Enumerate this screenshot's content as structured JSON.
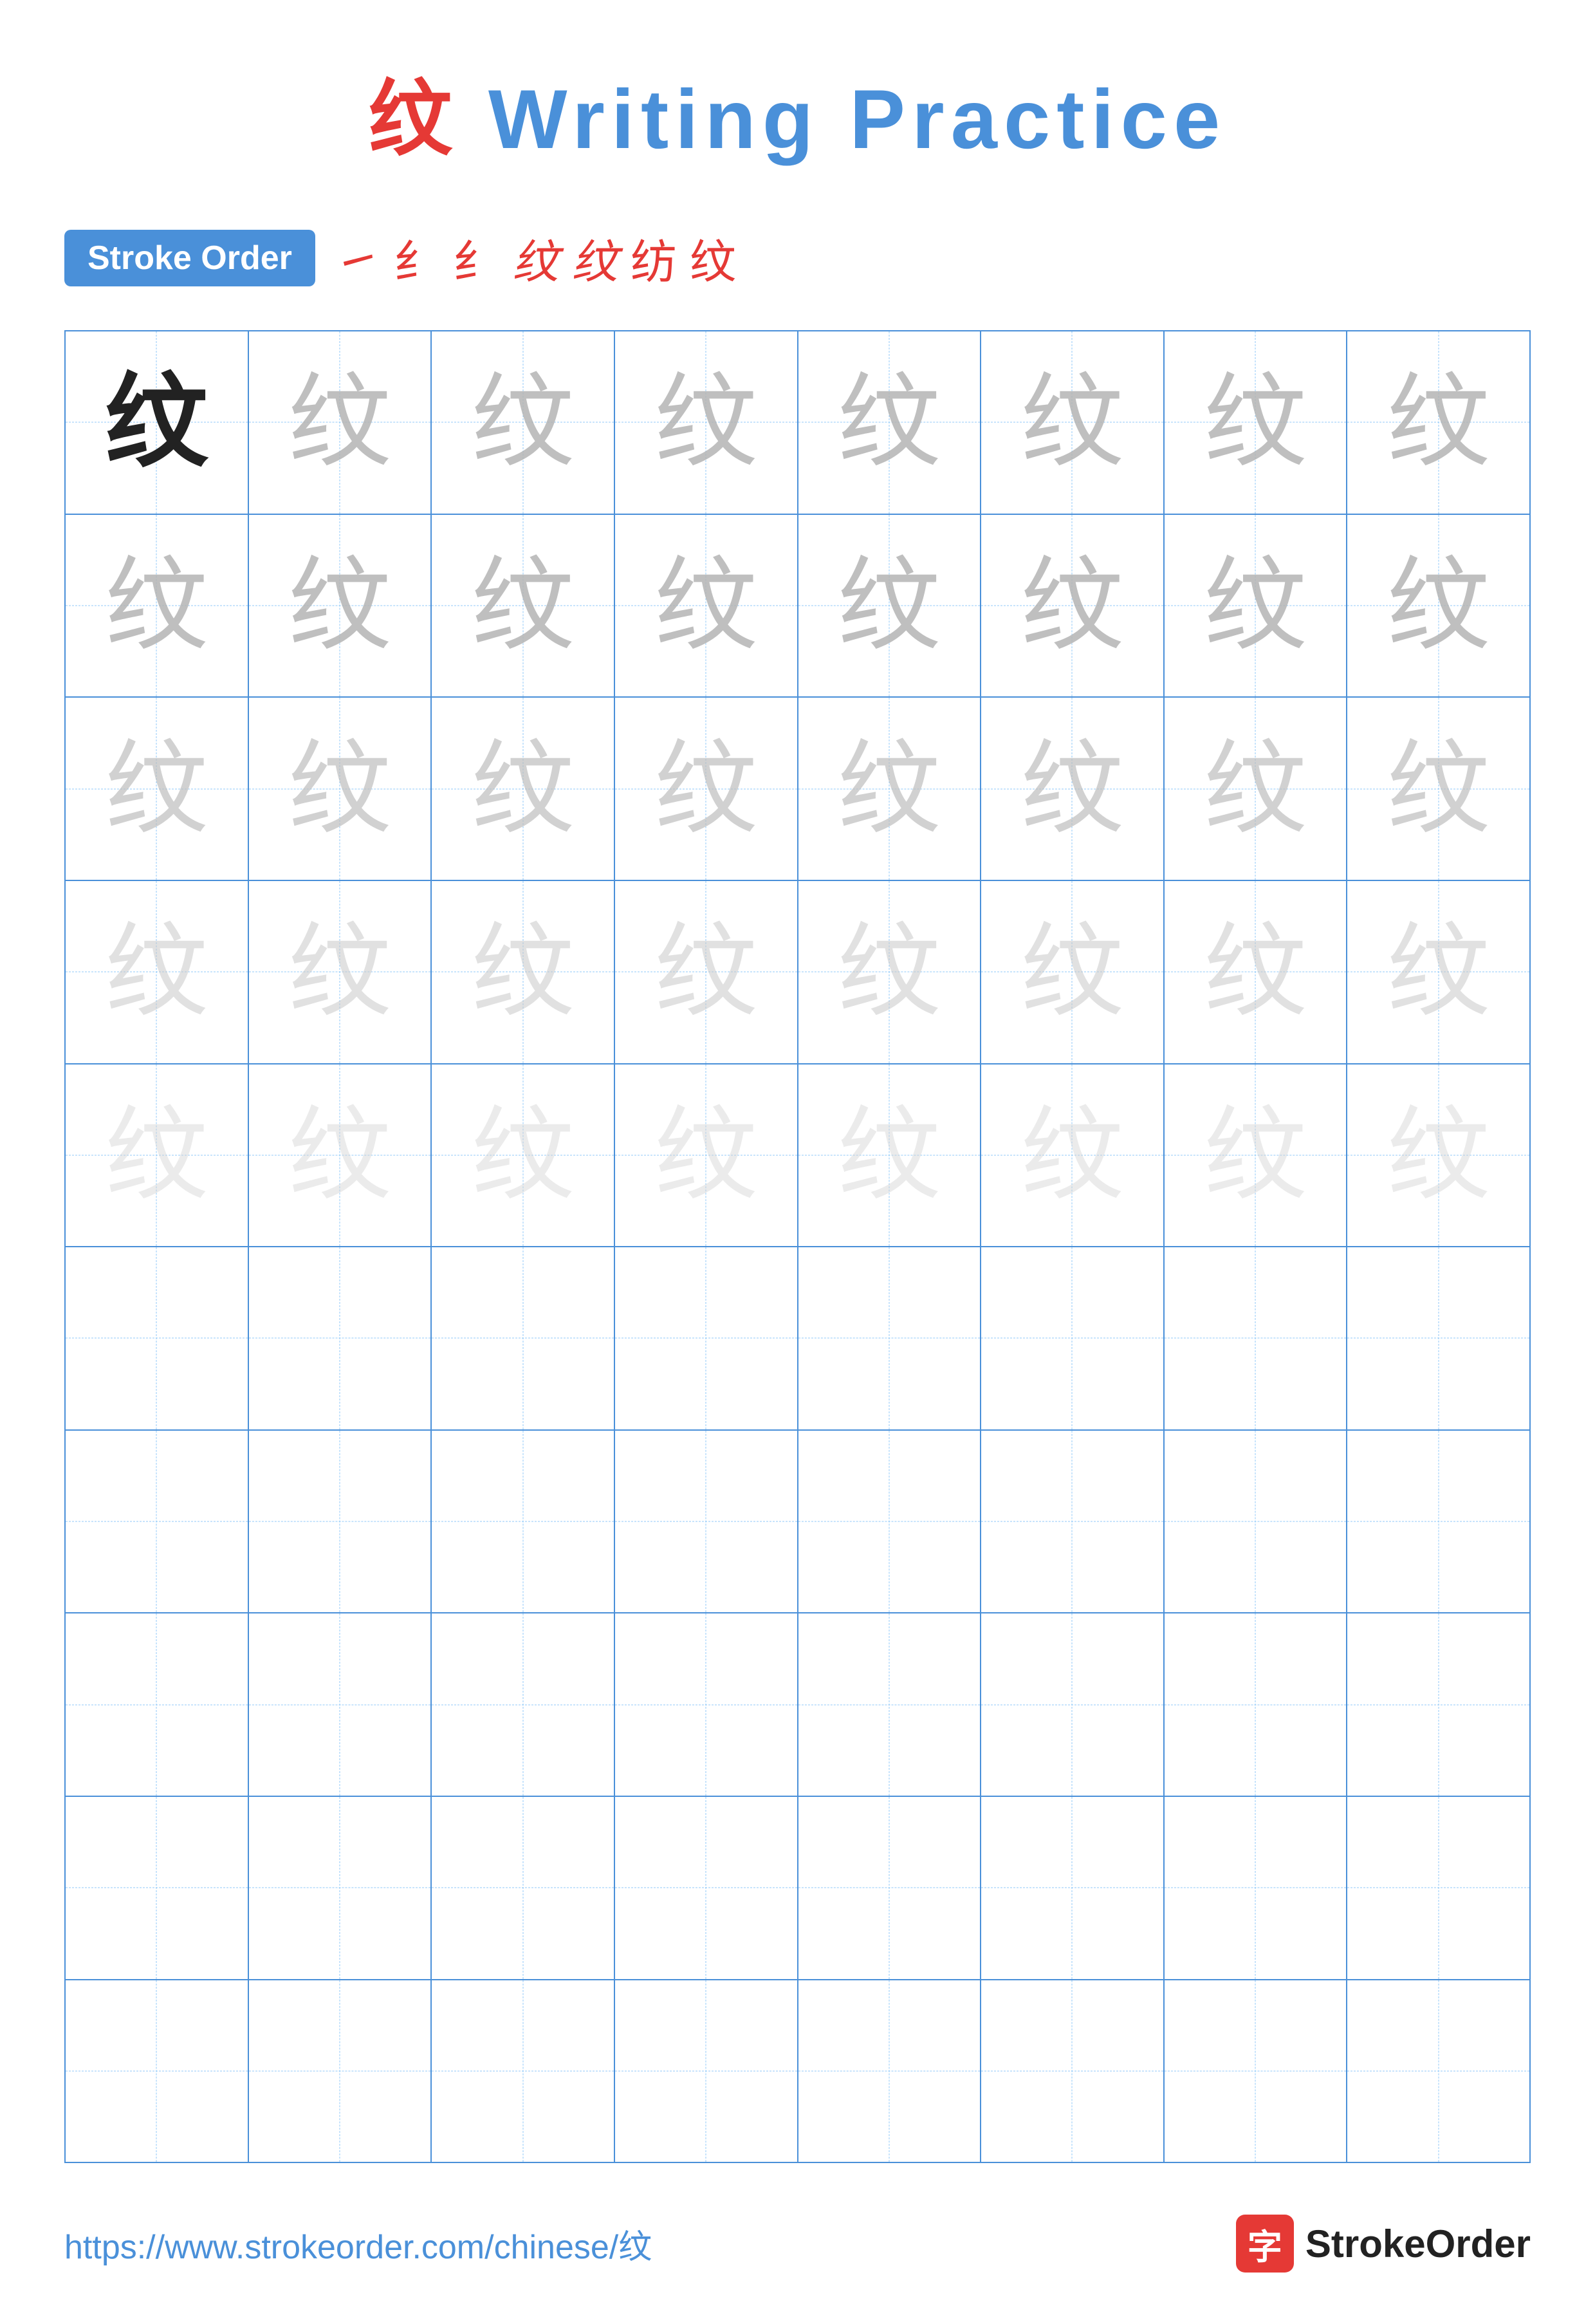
{
  "title": {
    "character": "纹",
    "rest": " Writing Practice"
  },
  "stroke_order": {
    "badge_label": "Stroke Order",
    "strokes": [
      "㇀",
      "纟",
      "纟",
      "纹̀",
      "纹̀",
      "纺",
      "纹"
    ]
  },
  "grid": {
    "rows": 10,
    "cols": 8,
    "character": "纹",
    "filled_rows": 5,
    "row_opacities": [
      "dark",
      "light-1",
      "light-2",
      "light-3",
      "light-4"
    ]
  },
  "footer": {
    "url": "https://www.strokeorder.com/chinese/纹",
    "logo_char": "字",
    "logo_text": "StrokeOrder"
  }
}
